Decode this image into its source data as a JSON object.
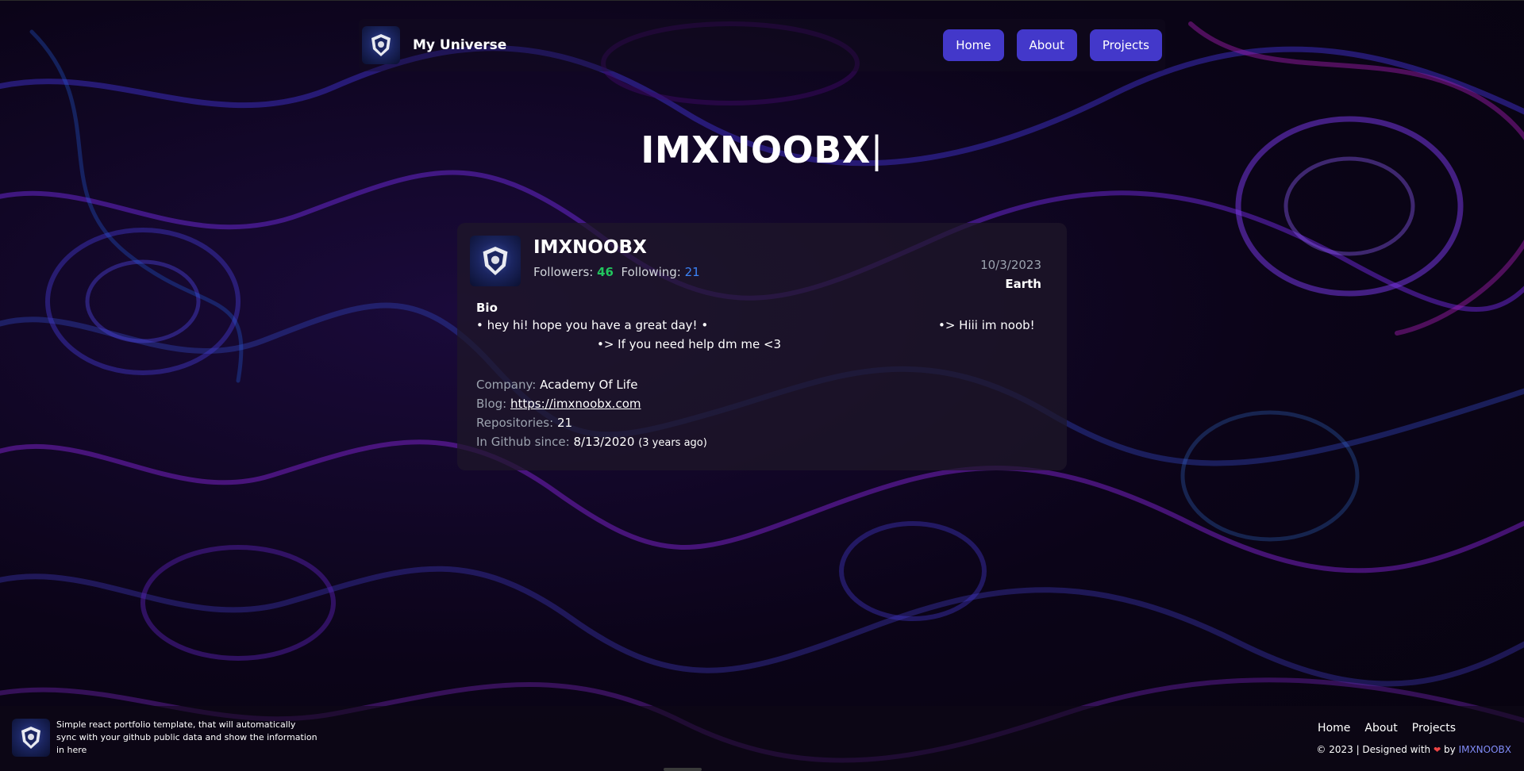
{
  "header": {
    "brand_title": "My Universe",
    "nav": [
      {
        "label": "Home"
      },
      {
        "label": "About"
      },
      {
        "label": "Projects"
      }
    ]
  },
  "hero": {
    "title": "IMXNOOBX",
    "cursor": "|"
  },
  "profile": {
    "username": "IMXNOOBX",
    "followers_label": "Followers:",
    "followers": "46",
    "following_label": "Following:",
    "following": "21",
    "date": "10/3/2023",
    "location": "Earth",
    "bio_label": "Bio",
    "bio_line1": "• hey hi! hope you have a great day! •",
    "bio_line2": "•> Hiii im noob!",
    "bio_line3": "•> If you need help dm me <3",
    "company_label": "Company:",
    "company": "Academy Of Life",
    "blog_label": "Blog:",
    "blog": "https://imxnoobx.com",
    "repos_label": "Repositories:",
    "repos": "21",
    "since_label": "In Github since:",
    "since": "8/13/2020",
    "since_rel": "(3 years ago)"
  },
  "footer": {
    "description": "Simple react portfolio template, that will automatically sync with your github public data and show the information in here",
    "nav": [
      {
        "label": "Home"
      },
      {
        "label": "About"
      },
      {
        "label": "Projects"
      }
    ],
    "copy_prefix": "© 2023 | Designed with",
    "copy_by": "by",
    "author": "IMXNOOBX"
  },
  "colors": {
    "accent": "#4338ca",
    "followers": "#22c55e",
    "following": "#3b82f6",
    "author": "#818cf8",
    "heart": "#ef4444"
  }
}
